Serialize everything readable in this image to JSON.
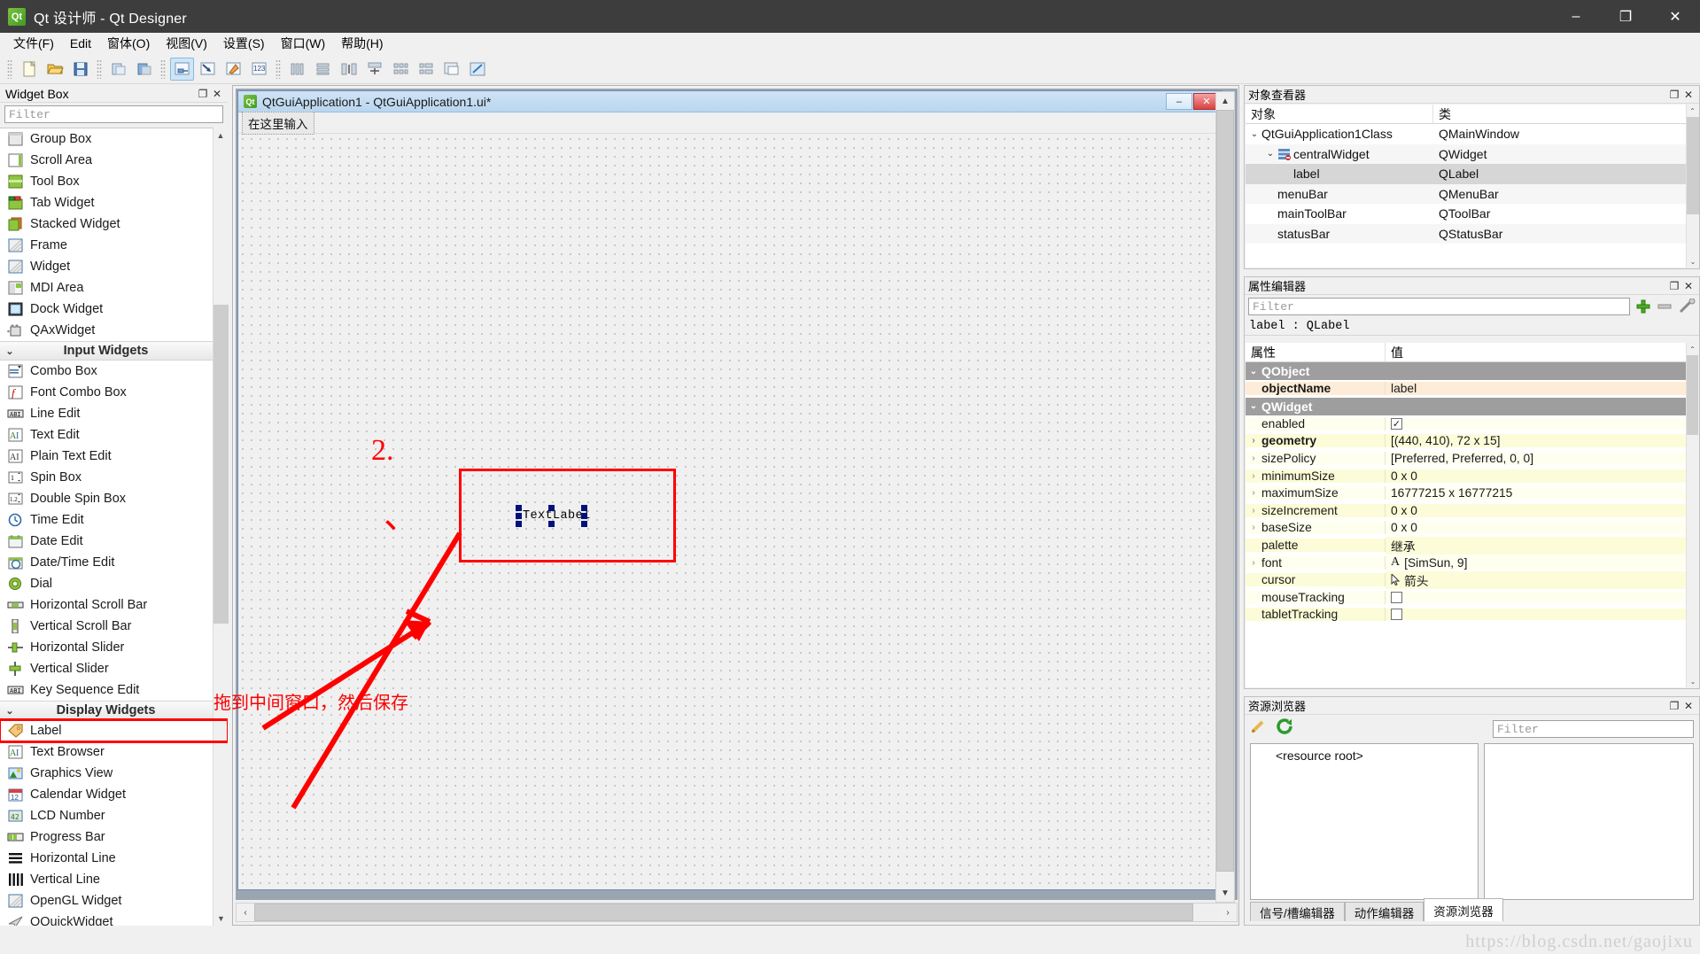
{
  "window": {
    "title": "Qt 设计师 - Qt Designer",
    "icon": "qt-logo-icon",
    "minimize_label": "–",
    "maximize_label": "❐",
    "close_label": "✕"
  },
  "menubar": {
    "items": [
      {
        "label": "文件(F)",
        "name": "menu-file"
      },
      {
        "label": "Edit",
        "name": "menu-edit"
      },
      {
        "label": "窗体(O)",
        "name": "menu-form"
      },
      {
        "label": "视图(V)",
        "name": "menu-view"
      },
      {
        "label": "设置(S)",
        "name": "menu-settings"
      },
      {
        "label": "窗口(W)",
        "name": "menu-window"
      },
      {
        "label": "帮助(H)",
        "name": "menu-help"
      }
    ]
  },
  "toolbar": {
    "groups": [
      {
        "buttons": [
          {
            "name": "new-form-button",
            "icon": "new-file-icon",
            "active": false
          },
          {
            "name": "open-form-button",
            "icon": "open-folder-icon",
            "active": false
          },
          {
            "name": "save-form-button",
            "icon": "save-disk-icon",
            "active": false
          }
        ]
      },
      {
        "buttons": [
          {
            "name": "undo-button",
            "icon": "undo-icon",
            "active": false
          },
          {
            "name": "redo-button",
            "icon": "redo-icon",
            "active": false
          }
        ]
      },
      {
        "buttons": [
          {
            "name": "edit-widgets-button",
            "icon": "edit-widgets-icon",
            "active": true
          },
          {
            "name": "edit-signals-slots-button",
            "icon": "signals-slots-icon",
            "active": false
          },
          {
            "name": "edit-buddies-button",
            "icon": "buddies-icon",
            "active": false
          },
          {
            "name": "edit-tab-order-button",
            "icon": "tab-order-icon",
            "active": false
          }
        ]
      },
      {
        "buttons": [
          {
            "name": "layout-horizontally-button",
            "icon": "layout-horizontal-icon",
            "active": false
          },
          {
            "name": "layout-vertically-button",
            "icon": "layout-vertical-icon",
            "active": false
          },
          {
            "name": "layout-splitter-horizontal-button",
            "icon": "splitter-horizontal-icon",
            "active": false
          },
          {
            "name": "layout-splitter-vertical-button",
            "icon": "splitter-vertical-icon",
            "active": false
          },
          {
            "name": "layout-grid-button",
            "icon": "layout-grid-icon",
            "active": false
          },
          {
            "name": "layout-form-button",
            "icon": "layout-form-icon",
            "active": false
          },
          {
            "name": "break-layout-button",
            "icon": "break-layout-icon",
            "active": false
          },
          {
            "name": "adjust-size-button",
            "icon": "adjust-size-icon",
            "active": false
          }
        ]
      }
    ]
  },
  "widget_box": {
    "title": "Widget Box",
    "float_label": "❐",
    "close_label": "✕",
    "filter_placeholder": "Filter",
    "scroll_up": "▲",
    "scroll_down": "▼",
    "rows": [
      {
        "type": "item",
        "label": "Group Box",
        "icon": "group-box-icon"
      },
      {
        "type": "item",
        "label": "Scroll Area",
        "icon": "scroll-area-icon"
      },
      {
        "type": "item",
        "label": "Tool Box",
        "icon": "tool-box-icon"
      },
      {
        "type": "item",
        "label": "Tab Widget",
        "icon": "tab-widget-icon"
      },
      {
        "type": "item",
        "label": "Stacked Widget",
        "icon": "stacked-widget-icon"
      },
      {
        "type": "item",
        "label": "Frame",
        "icon": "frame-icon"
      },
      {
        "type": "item",
        "label": "Widget",
        "icon": "widget-icon"
      },
      {
        "type": "item",
        "label": "MDI Area",
        "icon": "mdi-area-icon"
      },
      {
        "type": "item",
        "label": "Dock Widget",
        "icon": "dock-widget-icon"
      },
      {
        "type": "item",
        "label": "QAxWidget",
        "icon": "qax-widget-icon"
      },
      {
        "type": "category",
        "label": "Input Widgets",
        "icon": "chevron-down-icon"
      },
      {
        "type": "item",
        "label": "Combo Box",
        "icon": "combo-box-icon"
      },
      {
        "type": "item",
        "label": "Font Combo Box",
        "icon": "font-combo-box-icon"
      },
      {
        "type": "item",
        "label": "Line Edit",
        "icon": "line-edit-icon"
      },
      {
        "type": "item",
        "label": "Text Edit",
        "icon": "text-edit-icon"
      },
      {
        "type": "item",
        "label": "Plain Text Edit",
        "icon": "plain-text-edit-icon"
      },
      {
        "type": "item",
        "label": "Spin Box",
        "icon": "spin-box-icon"
      },
      {
        "type": "item",
        "label": "Double Spin Box",
        "icon": "double-spin-box-icon"
      },
      {
        "type": "item",
        "label": "Time Edit",
        "icon": "time-edit-icon"
      },
      {
        "type": "item",
        "label": "Date Edit",
        "icon": "date-edit-icon"
      },
      {
        "type": "item",
        "label": "Date/Time Edit",
        "icon": "date-time-edit-icon"
      },
      {
        "type": "item",
        "label": "Dial",
        "icon": "dial-icon"
      },
      {
        "type": "item",
        "label": "Horizontal Scroll Bar",
        "icon": "horizontal-scroll-bar-icon"
      },
      {
        "type": "item",
        "label": "Vertical Scroll Bar",
        "icon": "vertical-scroll-bar-icon"
      },
      {
        "type": "item",
        "label": "Horizontal Slider",
        "icon": "horizontal-slider-icon"
      },
      {
        "type": "item",
        "label": "Vertical Slider",
        "icon": "vertical-slider-icon"
      },
      {
        "type": "item",
        "label": "Key Sequence Edit",
        "icon": "key-sequence-edit-icon"
      },
      {
        "type": "category",
        "label": "Display Widgets",
        "icon": "chevron-down-icon"
      },
      {
        "type": "item",
        "label": "Label",
        "icon": "label-icon",
        "highlight": true
      },
      {
        "type": "item",
        "label": "Text Browser",
        "icon": "text-browser-icon"
      },
      {
        "type": "item",
        "label": "Graphics View",
        "icon": "graphics-view-icon"
      },
      {
        "type": "item",
        "label": "Calendar Widget",
        "icon": "calendar-widget-icon"
      },
      {
        "type": "item",
        "label": "LCD Number",
        "icon": "lcd-number-icon"
      },
      {
        "type": "item",
        "label": "Progress Bar",
        "icon": "progress-bar-icon"
      },
      {
        "type": "item",
        "label": "Horizontal Line",
        "icon": "horizontal-line-icon"
      },
      {
        "type": "item",
        "label": "Vertical Line",
        "icon": "vertical-line-icon"
      },
      {
        "type": "item",
        "label": "OpenGL Widget",
        "icon": "opengl-widget-icon"
      },
      {
        "type": "item",
        "label": "QQuickWidget",
        "icon": "qquick-widget-icon"
      }
    ]
  },
  "form_editor": {
    "window_title": "QtGuiApplication1 - QtGuiApplication1.ui*",
    "icon": "qt-logo-icon",
    "minimize_label": "–",
    "close_label": "✕",
    "menu_placeholder": "在这里输入",
    "label_widget_text": "TextLabel",
    "scroll_left": "‹",
    "scroll_right": "›",
    "scroll_up": "▲",
    "scroll_down": "▼"
  },
  "annotations": {
    "mark_1": "、",
    "mark_2": "2.",
    "note_text": "拖到中间窗口，然后保存",
    "color": "#ff0000"
  },
  "object_inspector": {
    "title": "对象查看器",
    "float_label": "❐",
    "close_label": "✕",
    "columns": [
      "对象",
      "类"
    ],
    "scroll_up": "⌃",
    "scroll_down": "⌄",
    "rows": [
      {
        "indent": 0,
        "chevron": "⌄",
        "icon": "",
        "name": "QtGuiApplication1Class",
        "class": "QMainWindow",
        "selected": false
      },
      {
        "indent": 1,
        "chevron": "⌄",
        "icon": "central-widget-icon",
        "name": "centralWidget",
        "class": "QWidget",
        "selected": false
      },
      {
        "indent": 2,
        "chevron": "",
        "icon": "",
        "name": "label",
        "class": "QLabel",
        "selected": true
      },
      {
        "indent": 1,
        "chevron": "",
        "icon": "",
        "name": "menuBar",
        "class": "QMenuBar",
        "selected": false
      },
      {
        "indent": 1,
        "chevron": "",
        "icon": "",
        "name": "mainToolBar",
        "class": "QToolBar",
        "selected": false
      },
      {
        "indent": 1,
        "chevron": "",
        "icon": "",
        "name": "statusBar",
        "class": "QStatusBar",
        "selected": false
      }
    ]
  },
  "property_editor": {
    "title": "属性编辑器",
    "float_label": "❐",
    "close_label": "✕",
    "filter_placeholder": "Filter",
    "add_button": "add-property-icon",
    "remove_button": "remove-property-icon",
    "configure_button": "configure-icon",
    "object_line": "label : QLabel",
    "columns": [
      "属性",
      "值"
    ],
    "scroll_up": "⌃",
    "scroll_down": "⌄",
    "rows": [
      {
        "kind": "group",
        "label": "QObject",
        "chevron": "⌄"
      },
      {
        "kind": "prop",
        "label": "objectName",
        "value": "label",
        "bold": true,
        "expandable": false,
        "style": "objname"
      },
      {
        "kind": "group",
        "label": "QWidget",
        "chevron": "⌄"
      },
      {
        "kind": "prop",
        "label": "enabled",
        "value": "",
        "checkbox": "checked",
        "expandable": false,
        "style": "white"
      },
      {
        "kind": "prop",
        "label": "geometry",
        "value": "[(440, 410), 72 x 15]",
        "bold": true,
        "expandable": true,
        "style": "yellow"
      },
      {
        "kind": "prop",
        "label": "sizePolicy",
        "value": "[Preferred, Preferred, 0, 0]",
        "expandable": true,
        "style": "white"
      },
      {
        "kind": "prop",
        "label": "minimumSize",
        "value": "0 x 0",
        "expandable": true,
        "style": "yellow"
      },
      {
        "kind": "prop",
        "label": "maximumSize",
        "value": "16777215 x 16777215",
        "expandable": true,
        "style": "white"
      },
      {
        "kind": "prop",
        "label": "sizeIncrement",
        "value": "0 x 0",
        "expandable": true,
        "style": "yellow"
      },
      {
        "kind": "prop",
        "label": "baseSize",
        "value": "0 x 0",
        "expandable": true,
        "style": "white"
      },
      {
        "kind": "prop",
        "label": "palette",
        "value": "继承",
        "expandable": false,
        "style": "yellow"
      },
      {
        "kind": "prop",
        "label": "font",
        "value": "[SimSun, 9]",
        "glyph": "A",
        "expandable": true,
        "style": "white"
      },
      {
        "kind": "prop",
        "label": "cursor",
        "value": "箭头",
        "glyph": "cursor-arrow-icon",
        "expandable": false,
        "style": "yellow"
      },
      {
        "kind": "prop",
        "label": "mouseTracking",
        "value": "",
        "checkbox": "unchecked",
        "expandable": false,
        "style": "white"
      },
      {
        "kind": "prop",
        "label": "tabletTracking",
        "value": "",
        "checkbox": "unchecked",
        "expandable": false,
        "style": "yellow"
      }
    ]
  },
  "resource_browser": {
    "title": "资源浏览器",
    "float_label": "❐",
    "close_label": "✕",
    "edit_button": "pencil-edit-icon",
    "reload_button": "reload-icon",
    "filter_placeholder": "Filter",
    "tree_root": "<resource root>",
    "tabs": [
      {
        "label": "信号/槽编辑器",
        "active": false
      },
      {
        "label": "动作编辑器",
        "active": false
      },
      {
        "label": "资源浏览器",
        "active": true
      }
    ]
  },
  "watermark": "https://blog.csdn.net/gaojixu"
}
